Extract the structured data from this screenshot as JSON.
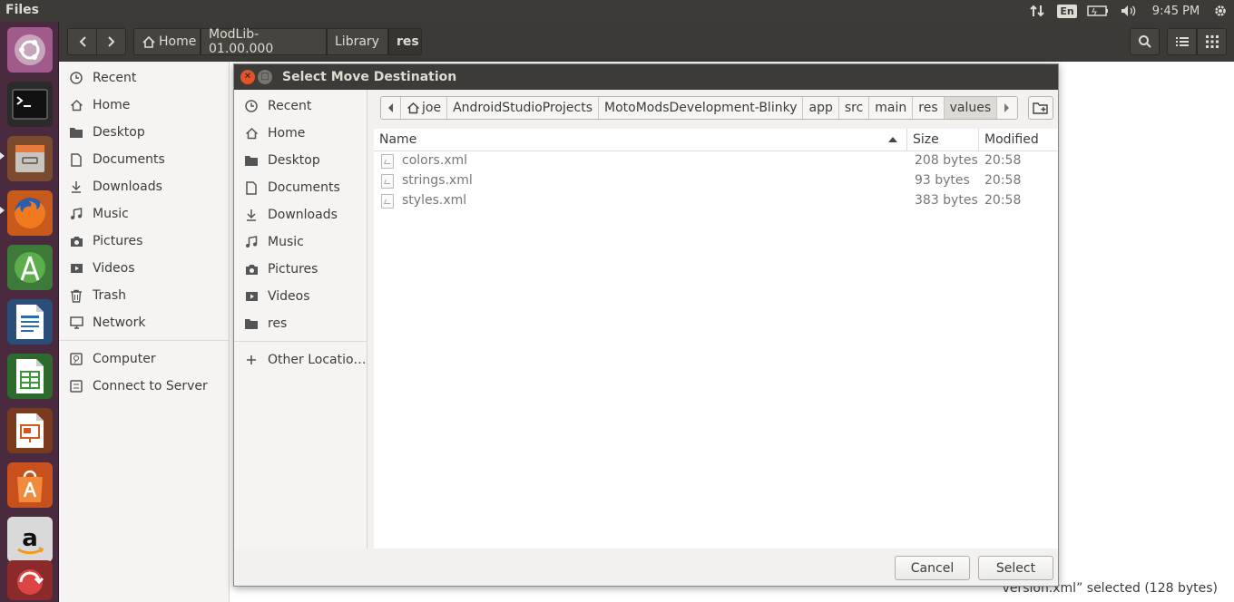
{
  "topbar": {
    "app_title": "Files",
    "keyboard_layout": "En",
    "clock": "9:45 PM"
  },
  "launcher": {
    "icons": [
      "ubuntu-dash-icon",
      "terminal-icon",
      "files-icon",
      "firefox-icon",
      "android-studio-icon",
      "libreoffice-writer-icon",
      "libreoffice-calc-icon",
      "libreoffice-impress-icon",
      "software-center-icon",
      "amazon-icon",
      "system-update-icon"
    ]
  },
  "files_window": {
    "breadcrumbs": [
      "Home",
      "ModLib-01.00.000",
      "Library",
      "res"
    ],
    "sidebar": [
      "Recent",
      "Home",
      "Desktop",
      "Documents",
      "Downloads",
      "Music",
      "Pictures",
      "Videos",
      "Trash",
      "Network",
      "Computer",
      "Connect to Server"
    ],
    "status": "“version.xml” selected  (128 bytes)"
  },
  "dialog": {
    "title": "Select Move Destination",
    "sidebar": [
      "Recent",
      "Home",
      "Desktop",
      "Documents",
      "Downloads",
      "Music",
      "Pictures",
      "Videos",
      "res",
      "Other Locatio…"
    ],
    "path": [
      "joe",
      "AndroidStudioProjects",
      "MotoModsDevelopment-Blinky",
      "app",
      "src",
      "main",
      "res",
      "values"
    ],
    "columns": {
      "name": "Name",
      "size": "Size",
      "modified": "Modified"
    },
    "files": [
      {
        "name": "colors.xml",
        "size": "208 bytes",
        "modified": "20:58"
      },
      {
        "name": "strings.xml",
        "size": "93 bytes",
        "modified": "20:58"
      },
      {
        "name": "styles.xml",
        "size": "383 bytes",
        "modified": "20:58"
      }
    ],
    "cancel_label": "Cancel",
    "select_label": "Select"
  }
}
